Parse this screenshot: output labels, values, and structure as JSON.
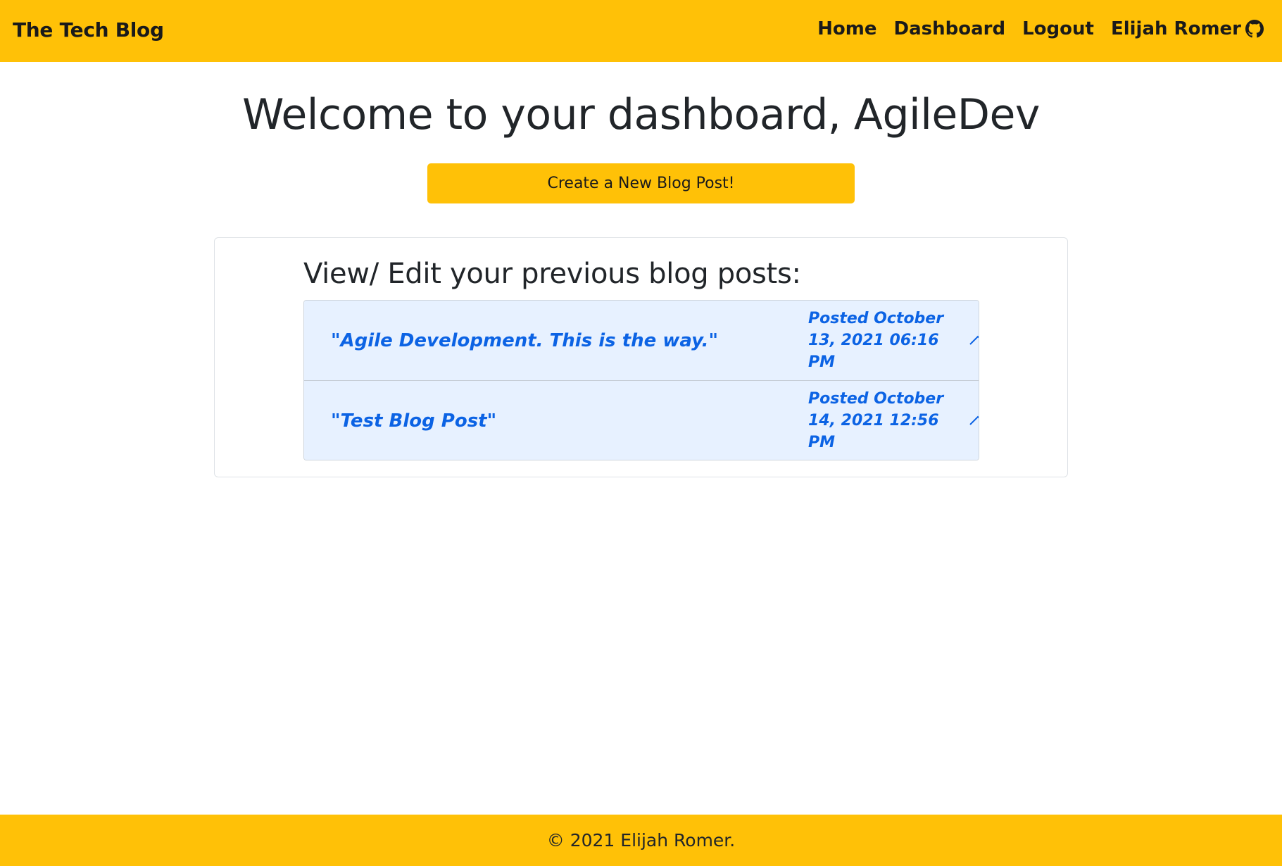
{
  "navbar": {
    "brand": "The Tech Blog",
    "links": {
      "home": "Home",
      "dashboard": "Dashboard",
      "logout": "Logout",
      "user": "Elijah Romer"
    },
    "user_icon": "github-icon"
  },
  "main": {
    "title": "Welcome to your dashboard, AgileDev",
    "create_button": "Create a New Blog Post!",
    "posts_heading": "View/ Edit your previous blog posts:",
    "posts": [
      {
        "title": "\"Agile Development. This is the way.\"",
        "date": "Posted October 13, 2021 06:16 PM",
        "icon": "chevron-up-icon"
      },
      {
        "title": "\"Test Blog Post\"",
        "date": "Posted October 14, 2021 12:56 PM",
        "icon": "chevron-up-icon"
      }
    ]
  },
  "footer": {
    "text": "© 2021 Elijah Romer."
  },
  "colors": {
    "brand_yellow": "#ffc107",
    "accordion_bg": "#e7f1ff",
    "accordion_text": "#0c63e4"
  }
}
